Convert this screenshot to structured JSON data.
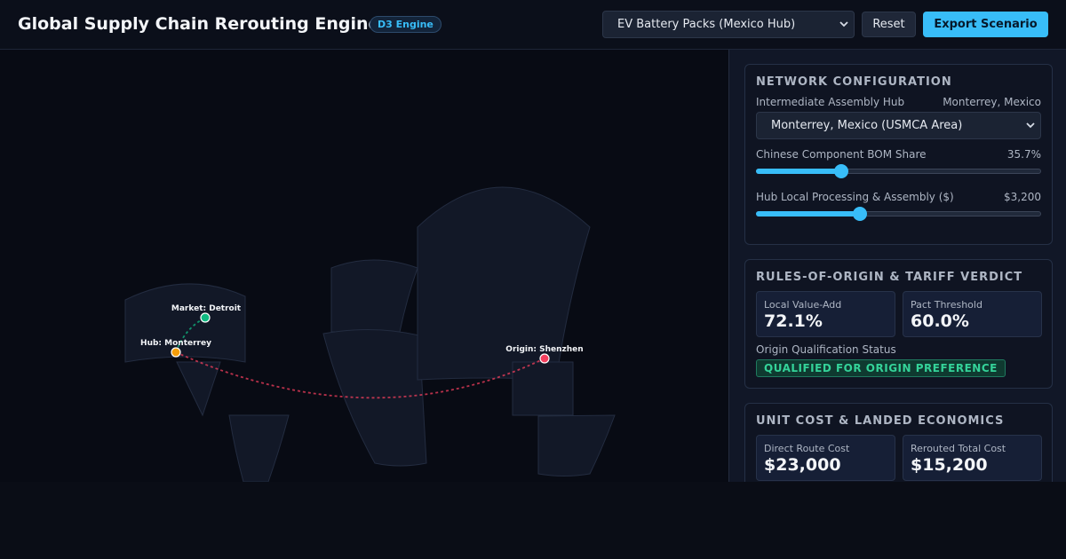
{
  "header": {
    "title": "Global Supply Chain Rerouting Engine",
    "badge": "D3 Engine",
    "scenario": "EV Battery Packs (Mexico Hub)",
    "reset_label": "Reset",
    "export_label": "Export Scenario"
  },
  "map": {
    "nodes": {
      "market": "Market: Detroit",
      "hub": "Hub: Monterrey",
      "origin": "Origin: Shenzhen"
    },
    "colors": {
      "market": "#10b981",
      "hub": "#f59e0b",
      "origin": "#f43f5e",
      "land": "#121827"
    }
  },
  "network": {
    "title": "NETWORK CONFIGURATION",
    "hub_label": "Intermediate Assembly Hub",
    "hub_value": "Monterrey, Mexico",
    "hub_select": "Monterrey, Mexico (USMCA Area)",
    "bom_label": "Chinese Component BOM Share",
    "bom_value": "35.7%",
    "bom_fraction": 0.3,
    "processing_label": "Hub Local Processing & Assembly ($)",
    "processing_value": "$3,200",
    "processing_fraction": 0.366
  },
  "verdict": {
    "title": "RULES-OF-ORIGIN & TARIFF VERDICT",
    "local_value_label": "Local Value-Add",
    "local_value": "72.1%",
    "threshold_label": "Pact Threshold",
    "threshold_value": "60.0%",
    "status_label": "Origin Qualification Status",
    "status": "QUALIFIED FOR ORIGIN PREFERENCE"
  },
  "economics": {
    "title": "UNIT COST & LANDED ECONOMICS",
    "direct_label": "Direct Route Cost",
    "direct_value": "$23,000",
    "rerouted_label": "Rerouted Total Cost",
    "rerouted_value": "$15,200"
  },
  "colors": {
    "accent": "#38bdf8",
    "qualified": "#34d399"
  }
}
